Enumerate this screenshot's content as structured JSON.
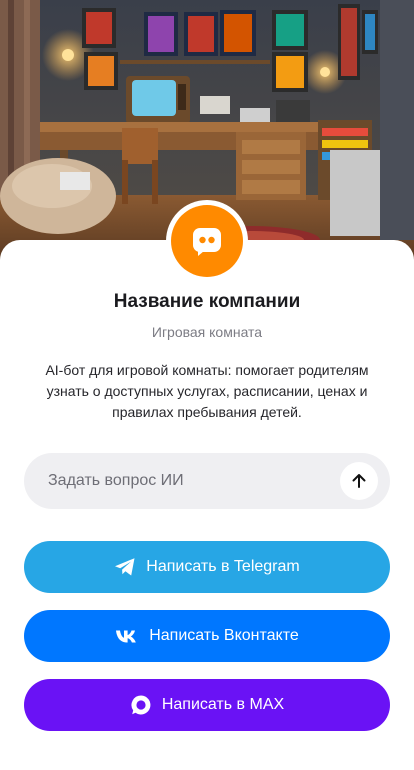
{
  "company": {
    "name": "Название компании",
    "category": "Игровая комната",
    "description": "AI-бот для игровой комнаты: помогает родителям узнать о доступных услугах, расписании, ценах и правилах пребывания детей.",
    "hero_image": "retro-gaming-room-photo",
    "avatar_icon": "chat-bot-icon",
    "avatar_color": "#ff8a00"
  },
  "ask": {
    "placeholder": "Задать вопрос ИИ",
    "send_icon": "arrow-up-icon"
  },
  "buttons": {
    "telegram": {
      "label": "Написать в Telegram",
      "icon": "telegram-icon",
      "color": "#27a6e5"
    },
    "vk": {
      "label": "Написать Вконтакте",
      "icon": "vk-icon",
      "color": "#0077ff"
    },
    "max": {
      "label": "Написать в MAX",
      "icon": "max-icon",
      "color": "#6a12f5"
    }
  }
}
